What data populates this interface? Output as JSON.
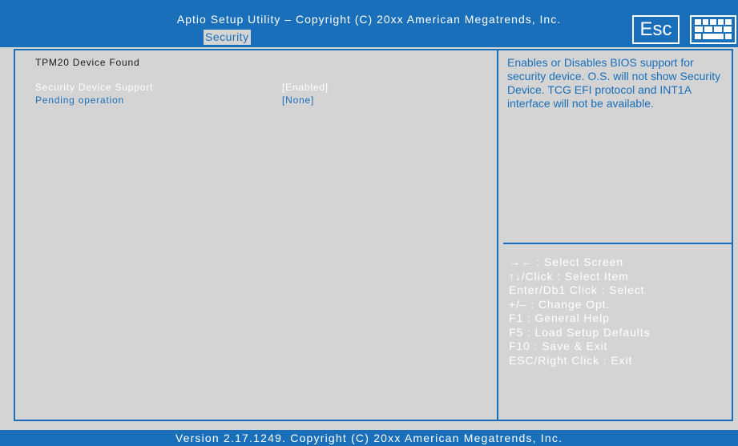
{
  "header": {
    "title": "Aptio Setup Utility – Copyright  (C)  20xx American Megatrends,  Inc.",
    "active_tab": "Security",
    "esc_label": "Esc",
    "keyboard_icon": "keyboard-icon"
  },
  "main": {
    "heading": "TPM20 Device Found",
    "options": [
      {
        "label": "Security Device Support",
        "value": "[Enabled]"
      },
      {
        "label": "Pending operation",
        "value": "[None]"
      }
    ]
  },
  "help": {
    "text": "Enables or Disables BIOS support for security device. O.S. will not show Security Device. TCG EFI protocol and INT1A interface will not be available."
  },
  "keys": [
    "→← :  Select Screen",
    "↑↓/Click :  Select Item",
    "Enter/Db1 Click :  Select",
    "+/– :  Change Opt.",
    "F1 :  General Help",
    "F5 :  Load Setup Defaults",
    "F10 :  Save & Exit",
    "ESC/Right Click :  Exit"
  ],
  "footer": {
    "text": "Version 2.17.1249.  Copyright  (C)  20xx American Megatrends,  Inc."
  },
  "colors": {
    "accent": "#1a6fba",
    "background": "#d4d4d4",
    "selected_text": "#ffffff",
    "normal_text": "#1a6fba"
  }
}
